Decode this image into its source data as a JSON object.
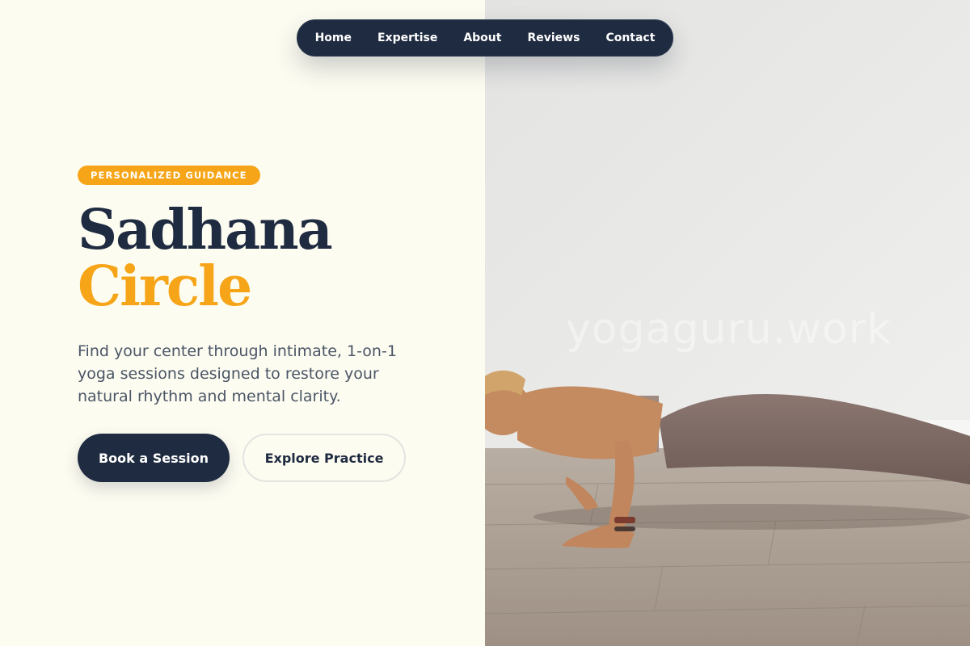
{
  "nav": {
    "items": [
      {
        "label": "Home"
      },
      {
        "label": "Expertise"
      },
      {
        "label": "About"
      },
      {
        "label": "Reviews"
      },
      {
        "label": "Contact"
      }
    ]
  },
  "hero": {
    "badge": "PERSONALIZED GUIDANCE",
    "title_line1": "Sadhana",
    "title_line2": "Circle",
    "description": "Find your center through intimate, 1-on-1 yoga sessions designed to restore your natural rhythm and mental clarity.",
    "primary_cta": "Book a Session",
    "secondary_cta": "Explore Practice"
  },
  "photo": {
    "watermark": "yogaguru.work",
    "subject": "woman holding chaturanga yoga pose on wooden floor"
  },
  "colors": {
    "navy": "#1f2b40",
    "accent": "#f7a518",
    "cream": "#fdfcf1",
    "body_text": "#4a5566"
  }
}
